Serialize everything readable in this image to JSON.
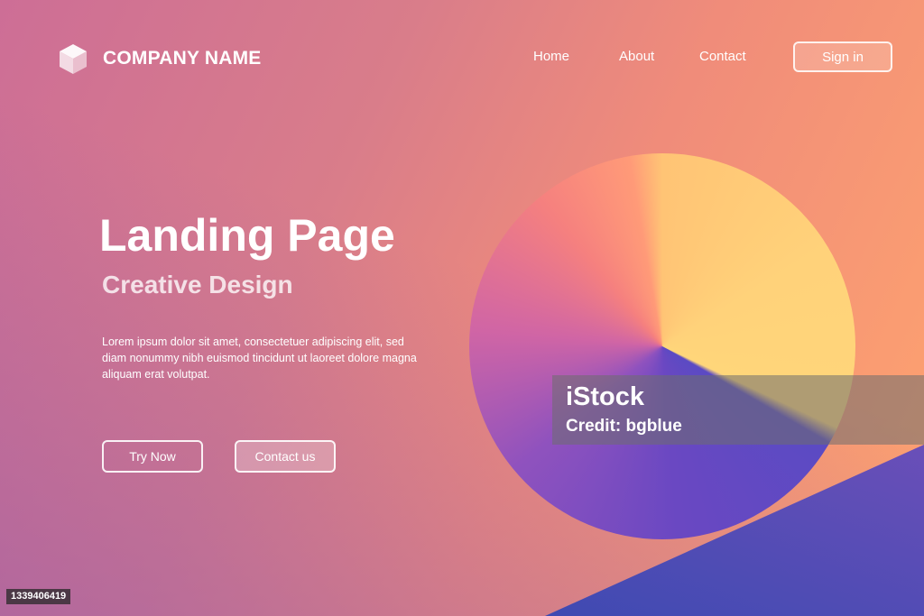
{
  "brand": {
    "name": "COMPANY NAME",
    "icon": "cube-icon"
  },
  "nav": {
    "items": [
      "Home",
      "About",
      "Contact"
    ],
    "signin_label": "Sign in"
  },
  "hero": {
    "title": "Landing Page",
    "subtitle": "Creative Design",
    "body": "Lorem ipsum dolor sit amet, consectetuer adipiscing elit, sed diam nonummy nibh euismod tincidunt ut laoreet dolore magna aliquam erat volutpat.",
    "primary_button": "Try Now",
    "secondary_button": "Contact us"
  },
  "watermark": {
    "brand": "iStock",
    "credit": "Credit: bgblue"
  },
  "image_id": "1339406419",
  "colors": {
    "pink": "#cd6e96",
    "orange": "#ffa46e",
    "yellow": "#ffd67a",
    "violet": "#5b4ac3"
  }
}
